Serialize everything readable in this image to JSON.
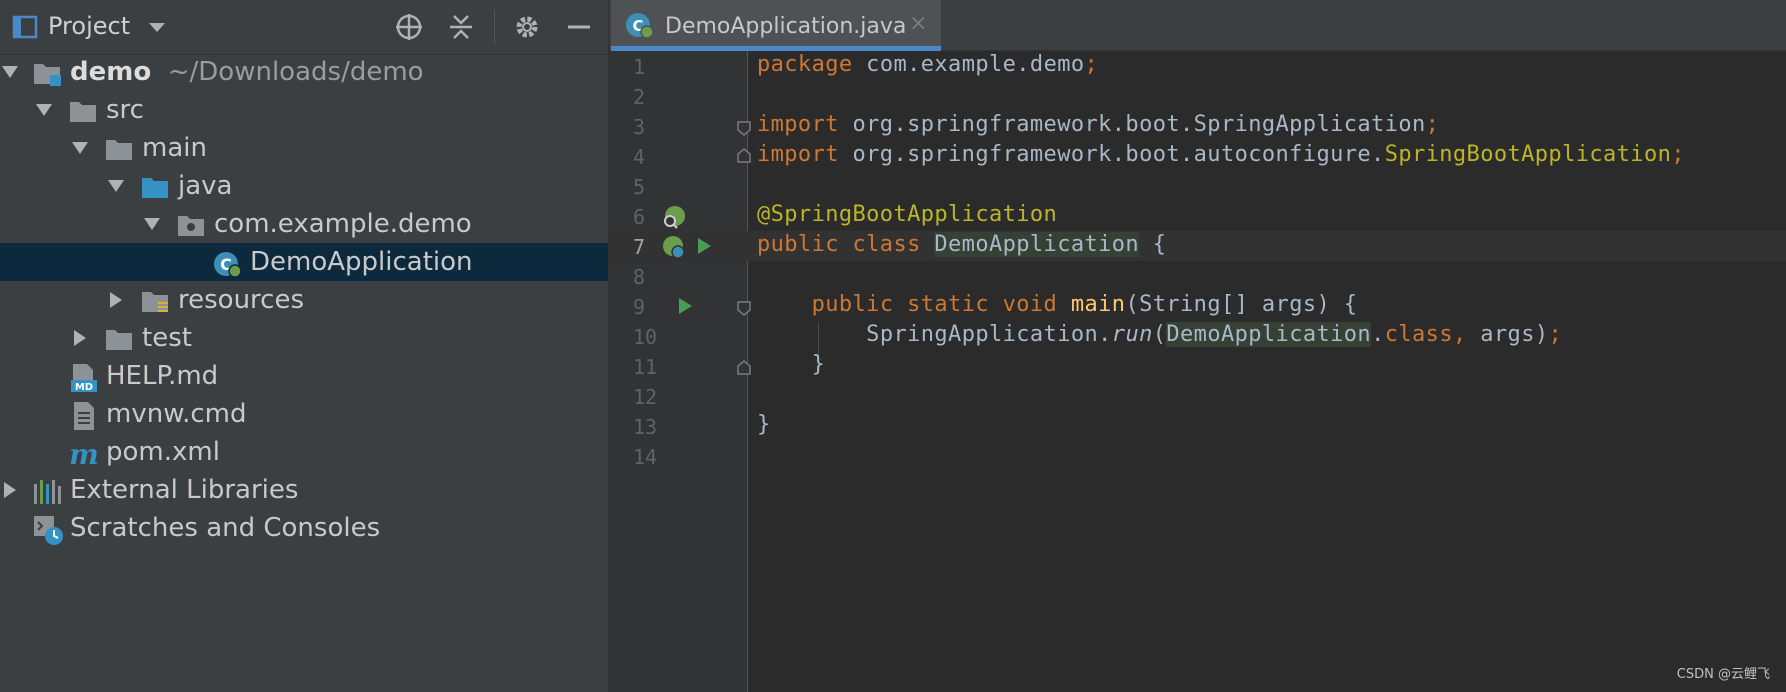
{
  "project_panel": {
    "title": "Project",
    "tree": [
      {
        "label": "demo",
        "path": "~/Downloads/demo",
        "icon": "module-folder-icon"
      },
      {
        "label": "src",
        "icon": "folder-icon"
      },
      {
        "label": "main",
        "icon": "folder-icon"
      },
      {
        "label": "java",
        "icon": "source-folder-icon"
      },
      {
        "label": "com.example.demo",
        "icon": "package-icon"
      },
      {
        "label": "DemoApplication",
        "icon": "spring-boot-class-icon"
      },
      {
        "label": "resources",
        "icon": "resources-folder-icon"
      },
      {
        "label": "test",
        "icon": "folder-icon"
      },
      {
        "label": "HELP.md",
        "icon": "markdown-file-icon"
      },
      {
        "label": "mvnw.cmd",
        "icon": "text-file-icon"
      },
      {
        "label": "pom.xml",
        "icon": "maven-icon"
      },
      {
        "label": "External Libraries",
        "icon": "libraries-icon"
      },
      {
        "label": "Scratches and Consoles",
        "icon": "scratches-icon"
      }
    ]
  },
  "editor": {
    "tab": {
      "label": "DemoApplication.java",
      "close": "×"
    },
    "line_numbers": [
      "1",
      "2",
      "3",
      "4",
      "5",
      "6",
      "7",
      "8",
      "9",
      "10",
      "11",
      "12",
      "13",
      "14"
    ],
    "code": {
      "l1": {
        "kw": "package",
        "text": " com.example.demo",
        "semi": ";"
      },
      "l3": {
        "kw": "import",
        "text": " org.springframework.boot.SpringApplication",
        "semi": ";"
      },
      "l4": {
        "kw": "import",
        "text": " org.springframework.boot.autoconfigure.",
        "ann": "SpringBootApplication",
        "semi": ";"
      },
      "l6": {
        "ann": "@SpringBootApplication"
      },
      "l7": {
        "kw": "public class ",
        "cls": "DemoApplication",
        "rest": " {"
      },
      "l9": {
        "indent": "    ",
        "kw": "public static void ",
        "fn": "main",
        "rest": "(String[] args) {"
      },
      "l10": {
        "indent": "        ",
        "text1": "SpringApplication.",
        "it": "run",
        "p1": "(",
        "cls": "DemoApplication",
        "p2": ".",
        "kw": "class",
        "comma": ",",
        "rest": " args)",
        "semi": ";"
      },
      "l11": {
        "indent": "    ",
        "text": "}"
      },
      "l13": {
        "text": "}"
      }
    }
  },
  "watermark": "CSDN @云鲤飞",
  "colors": {
    "keyword": "#cc7832",
    "annotation": "#bbb529",
    "function": "#ffc66d",
    "default": "#a9b7c6",
    "selection": "#0d293e",
    "tab_accent": "#4a88c7"
  }
}
